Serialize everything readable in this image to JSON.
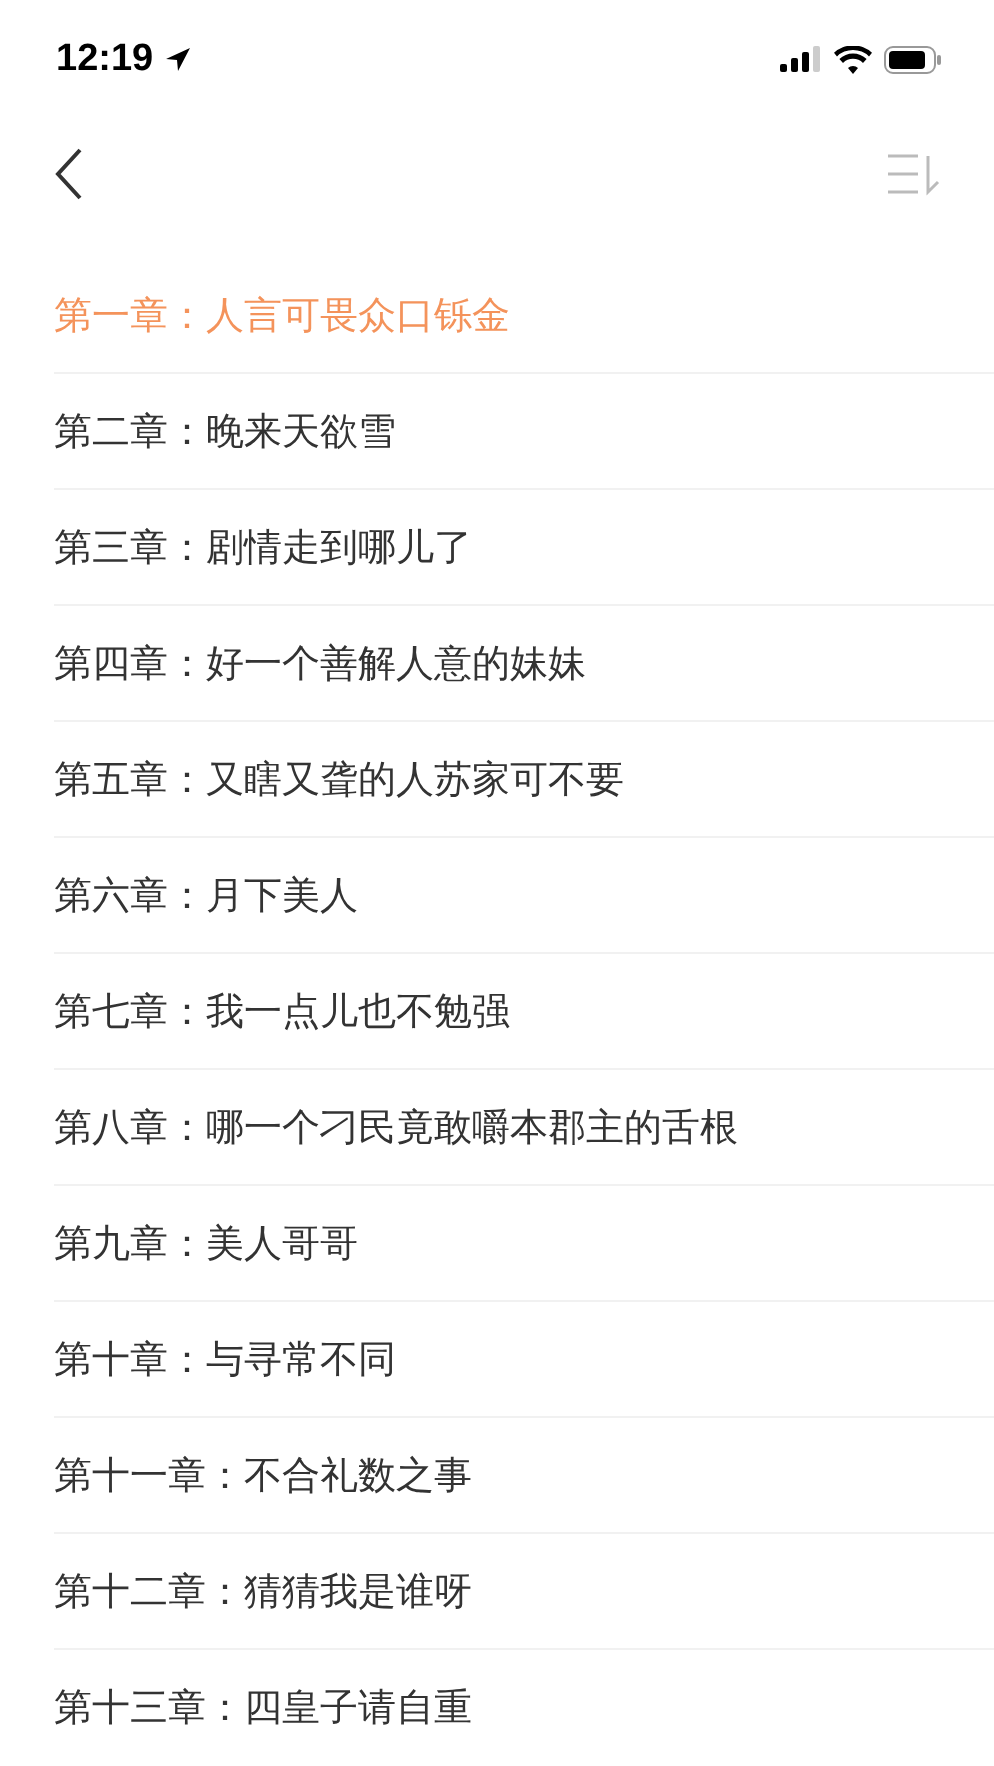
{
  "status_bar": {
    "time": "12:19"
  },
  "chapters": [
    {
      "title": "第一章：人言可畏众口铄金",
      "selected": true
    },
    {
      "title": "第二章：晚来天欲雪",
      "selected": false
    },
    {
      "title": "第三章：剧情走到哪儿了",
      "selected": false
    },
    {
      "title": "第四章：好一个善解人意的妹妹",
      "selected": false
    },
    {
      "title": "第五章：又瞎又聋的人苏家可不要",
      "selected": false
    },
    {
      "title": "第六章：月下美人",
      "selected": false
    },
    {
      "title": "第七章：我一点儿也不勉强",
      "selected": false
    },
    {
      "title": "第八章：哪一个刁民竟敢嚼本郡主的舌根",
      "selected": false
    },
    {
      "title": "第九章：美人哥哥",
      "selected": false
    },
    {
      "title": "第十章：与寻常不同",
      "selected": false
    },
    {
      "title": "第十一章：不合礼数之事",
      "selected": false
    },
    {
      "title": "第十二章：猜猜我是谁呀",
      "selected": false
    },
    {
      "title": "第十三章：四皇子请自重",
      "selected": false
    }
  ]
}
